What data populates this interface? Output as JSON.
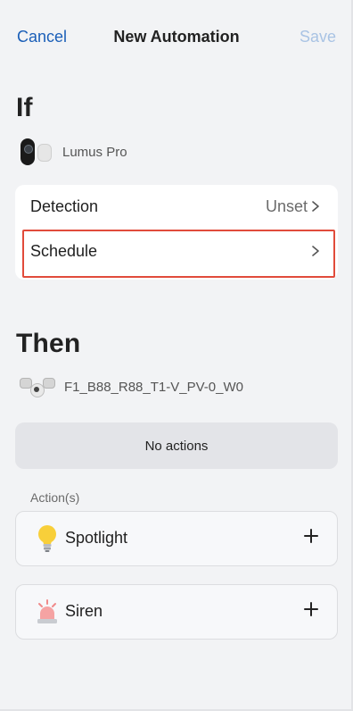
{
  "header": {
    "cancel_label": "Cancel",
    "title": "New Automation",
    "save_label": "Save"
  },
  "if_section": {
    "title": "If",
    "device_name": "Lumus Pro",
    "rows": [
      {
        "label": "Detection",
        "value": "Unset"
      },
      {
        "label": "Schedule",
        "value": ""
      }
    ]
  },
  "then_section": {
    "title": "Then",
    "device_name": "F1_B88_R88_T1-V_PV-0_W0",
    "empty_text": "No actions",
    "actions_label": "Action(s)",
    "actions": [
      {
        "name": "Spotlight",
        "icon": "light-bulb-icon"
      },
      {
        "name": "Siren",
        "icon": "siren-icon"
      }
    ]
  },
  "colors": {
    "accent": "#1b5fb8",
    "save_disabled": "#a9c3e4",
    "highlight_border": "#e14b3b",
    "background": "#f2f3f5"
  }
}
